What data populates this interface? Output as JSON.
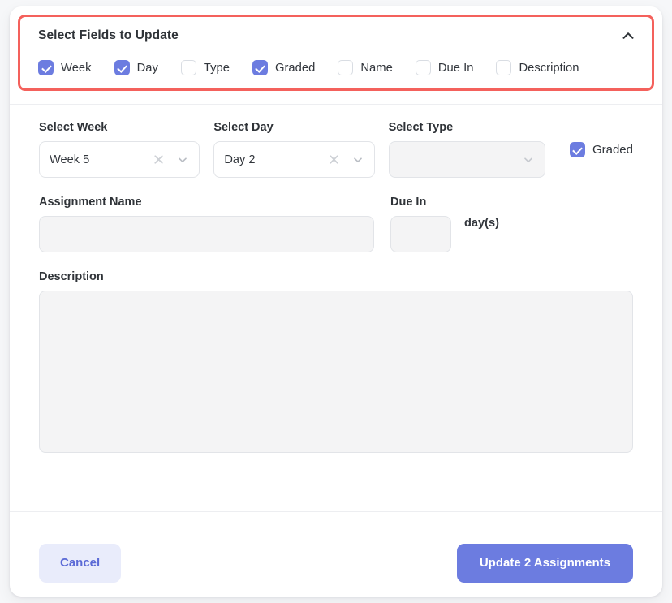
{
  "field_panel": {
    "title": "Select Fields to Update",
    "collapse_icon": "chevron-up-icon",
    "highlight_color": "#f4615c",
    "accent_color": "#6c7ce0",
    "fields": [
      {
        "label": "Week",
        "checked": true
      },
      {
        "label": "Day",
        "checked": true
      },
      {
        "label": "Type",
        "checked": false
      },
      {
        "label": "Graded",
        "checked": true
      },
      {
        "label": "Name",
        "checked": false
      },
      {
        "label": "Due In",
        "checked": false
      },
      {
        "label": "Description",
        "checked": false
      }
    ]
  },
  "form": {
    "week": {
      "label": "Select Week",
      "value": "Week 5",
      "clear_icon": "close-x-icon",
      "chevron_icon": "chevron-down-icon"
    },
    "day": {
      "label": "Select Day",
      "value": "Day 2",
      "clear_icon": "close-x-icon",
      "chevron_icon": "chevron-down-icon"
    },
    "type": {
      "label": "Select Type",
      "value": "",
      "chevron_icon": "chevron-down-icon"
    },
    "graded": {
      "label": "Graded",
      "checked": true
    },
    "assignment_name": {
      "label": "Assignment Name",
      "value": "",
      "placeholder": ""
    },
    "due_in": {
      "label": "Due In",
      "value": "",
      "placeholder": "",
      "unit": "day(s)"
    },
    "description": {
      "label": "Description",
      "value": ""
    }
  },
  "footer": {
    "cancel_label": "Cancel",
    "update_label": "Update 2 Assignments"
  }
}
